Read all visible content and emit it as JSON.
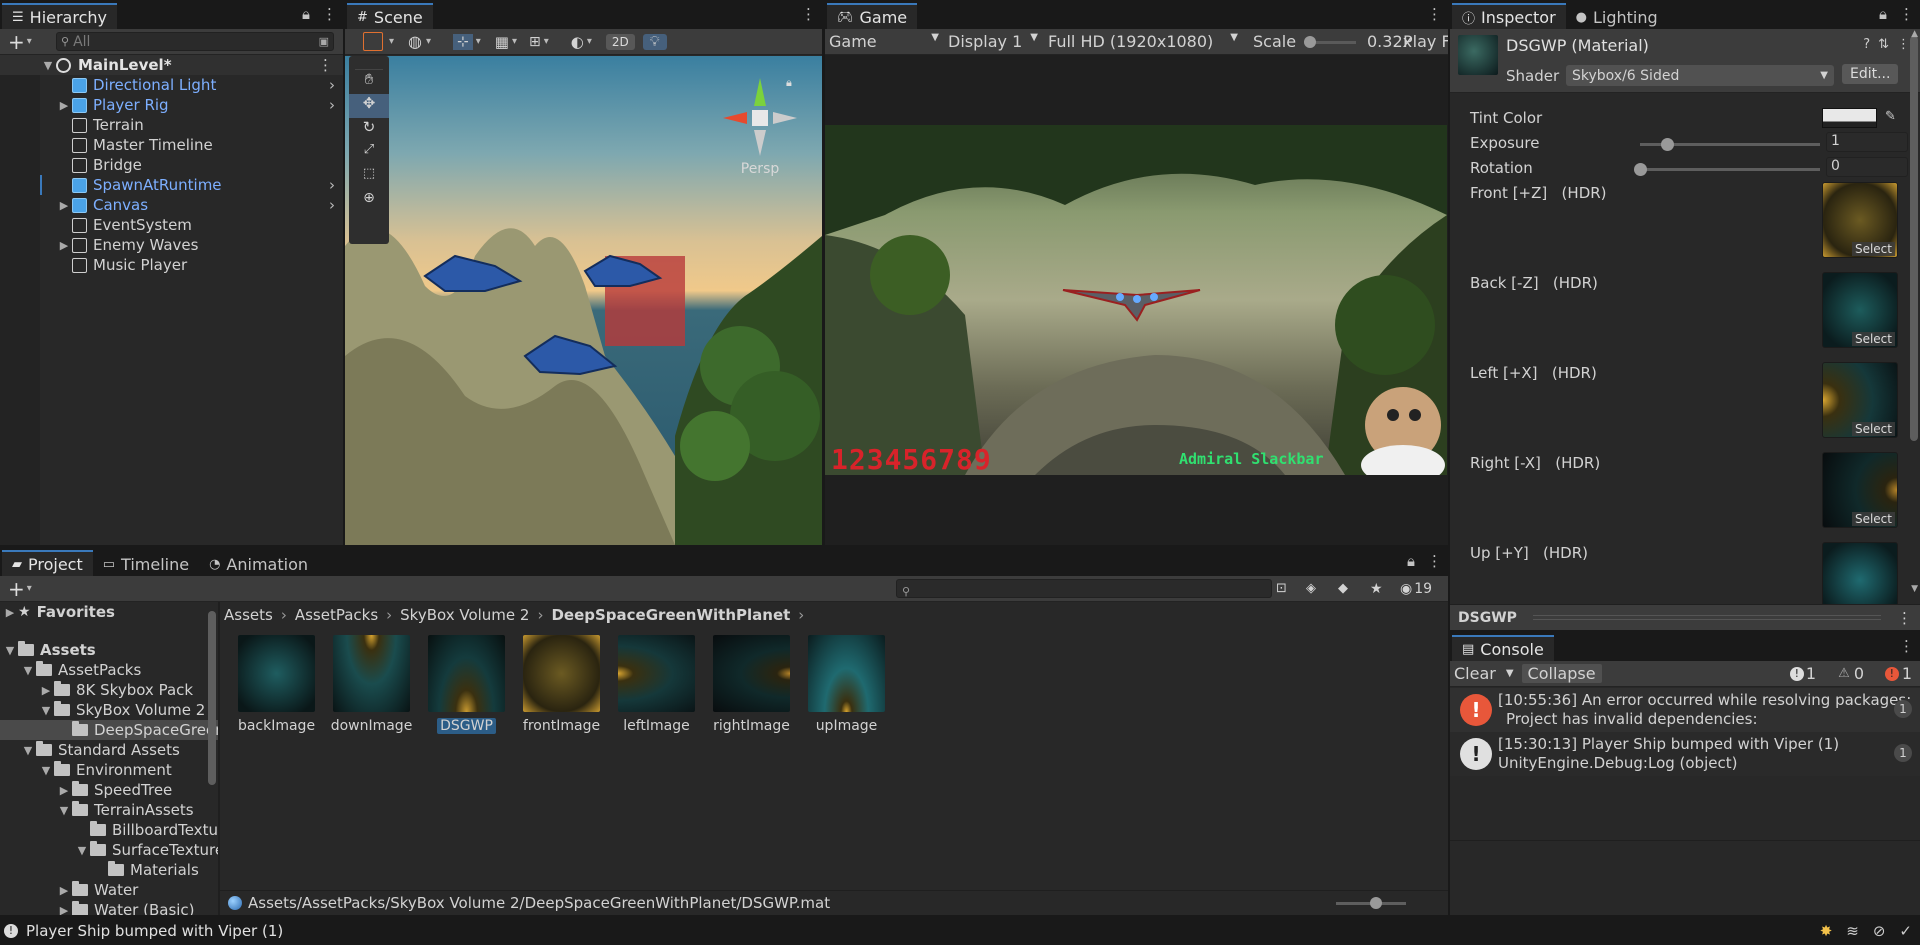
{
  "hierarchy": {
    "tab": "Hierarchy",
    "search_placeholder": "All",
    "scene": "MainLevel*",
    "items": [
      {
        "label": "Directional Light",
        "prefab": true,
        "arrow": false,
        "chevron": true
      },
      {
        "label": "Player Rig",
        "prefab": true,
        "arrow": true,
        "chevron": true
      },
      {
        "label": "Terrain",
        "prefab": false,
        "arrow": false,
        "chevron": false
      },
      {
        "label": "Master Timeline",
        "prefab": false,
        "arrow": false,
        "chevron": false
      },
      {
        "label": "Bridge",
        "prefab": false,
        "arrow": false,
        "chevron": false
      },
      {
        "label": "SpawnAtRuntime",
        "prefab": true,
        "arrow": false,
        "chevron": true
      },
      {
        "label": "Canvas",
        "prefab": true,
        "arrow": true,
        "chevron": true
      },
      {
        "label": "EventSystem",
        "prefab": false,
        "arrow": false,
        "chevron": false
      },
      {
        "label": "Enemy Waves",
        "prefab": false,
        "arrow": true,
        "chevron": false
      },
      {
        "label": "Music Player",
        "prefab": false,
        "arrow": false,
        "chevron": false
      }
    ]
  },
  "scene": {
    "tab": "Scene",
    "toggle_2d": "2D",
    "persp": "Persp"
  },
  "game": {
    "tab": "Game",
    "mode": "Game",
    "display": "Display 1",
    "resolution": "Full HD (1920x1080)",
    "scale_label": "Scale",
    "scale_value": "0.32x",
    "play_label": "Play F",
    "score": "123456789",
    "player_name": "Admiral Slackbar"
  },
  "inspector": {
    "tab": "Inspector",
    "tab2": "Lighting",
    "title": "DSGWP (Material)",
    "shader_label": "Shader",
    "shader_value": "Skybox/6 Sided",
    "edit_button": "Edit...",
    "tint_label": "Tint Color",
    "exposure_label": "Exposure",
    "exposure_value": "1",
    "exposure_level": 0.15,
    "rotation_label": "Rotation",
    "rotation_value": "0",
    "rotation_level": 0,
    "textures": [
      {
        "label": "Front [+Z]   (HDR)"
      },
      {
        "label": "Back [-Z]   (HDR)"
      },
      {
        "label": "Left [+X]   (HDR)"
      },
      {
        "label": "Right [-X]   (HDR)"
      },
      {
        "label": "Up [+Y]   (HDR)"
      }
    ],
    "select_label": "Select",
    "preview_label": "DSGWP"
  },
  "project": {
    "tab": "Project",
    "tab2": "Timeline",
    "tab3": "Animation",
    "hidden_count": "19",
    "favorites": "Favorites",
    "tree": [
      {
        "label": "Assets",
        "indent": 0,
        "open": true
      },
      {
        "label": "AssetPacks",
        "indent": 1,
        "open": true
      },
      {
        "label": "8K Skybox Pack",
        "indent": 2,
        "open": false
      },
      {
        "label": "SkyBox Volume 2",
        "indent": 2,
        "open": true
      },
      {
        "label": "DeepSpaceGreenWithPlanet",
        "indent": 3,
        "open": null,
        "selected": true
      },
      {
        "label": "Standard Assets",
        "indent": 1,
        "open": true
      },
      {
        "label": "Environment",
        "indent": 2,
        "open": true
      },
      {
        "label": "SpeedTree",
        "indent": 3,
        "open": false
      },
      {
        "label": "TerrainAssets",
        "indent": 3,
        "open": true
      },
      {
        "label": "BillboardTextures",
        "indent": 4,
        "open": null
      },
      {
        "label": "SurfaceTextures",
        "indent": 4,
        "open": true
      },
      {
        "label": "Materials",
        "indent": 5,
        "open": null
      },
      {
        "label": "Water",
        "indent": 3,
        "open": false
      },
      {
        "label": "Water (Basic)",
        "indent": 3,
        "open": false
      }
    ],
    "breadcrumb": [
      "Assets",
      "AssetPacks",
      "SkyBox Volume 2",
      "DeepSpaceGreenWithPlanet"
    ],
    "assets": [
      {
        "label": "backImage",
        "selected": false
      },
      {
        "label": "downImage",
        "selected": false
      },
      {
        "label": "DSGWP",
        "selected": true
      },
      {
        "label": "frontImage",
        "selected": false
      },
      {
        "label": "leftImage",
        "selected": false
      },
      {
        "label": "rightImage",
        "selected": false
      },
      {
        "label": "upImage",
        "selected": false
      }
    ],
    "path": "Assets/AssetPacks/SkyBox Volume 2/DeepSpaceGreenWithPlanet/DSGWP.mat"
  },
  "console": {
    "tab": "Console",
    "clear": "Clear",
    "collapse": "Collapse",
    "count_info": "1",
    "count_warn": "0",
    "count_error": "1",
    "entries": [
      {
        "line1": "[10:55:36] An error occurred while resolving packages:",
        "line2": "Project has invalid dependencies:",
        "count": "1",
        "type": "error"
      },
      {
        "line1": "[15:30:13] Player Ship bumped with Viper (1)",
        "line2": "UnityEngine.Debug:Log (object)",
        "count": "1",
        "type": "info"
      }
    ]
  },
  "statusbar": {
    "message": "Player Ship bumped with Viper (1)"
  },
  "colors": {
    "accent": "#3a79bb",
    "prefab_text": "#7dafff",
    "error": "#e8573a",
    "score": "#d8232a",
    "player_name": "#30e070"
  }
}
